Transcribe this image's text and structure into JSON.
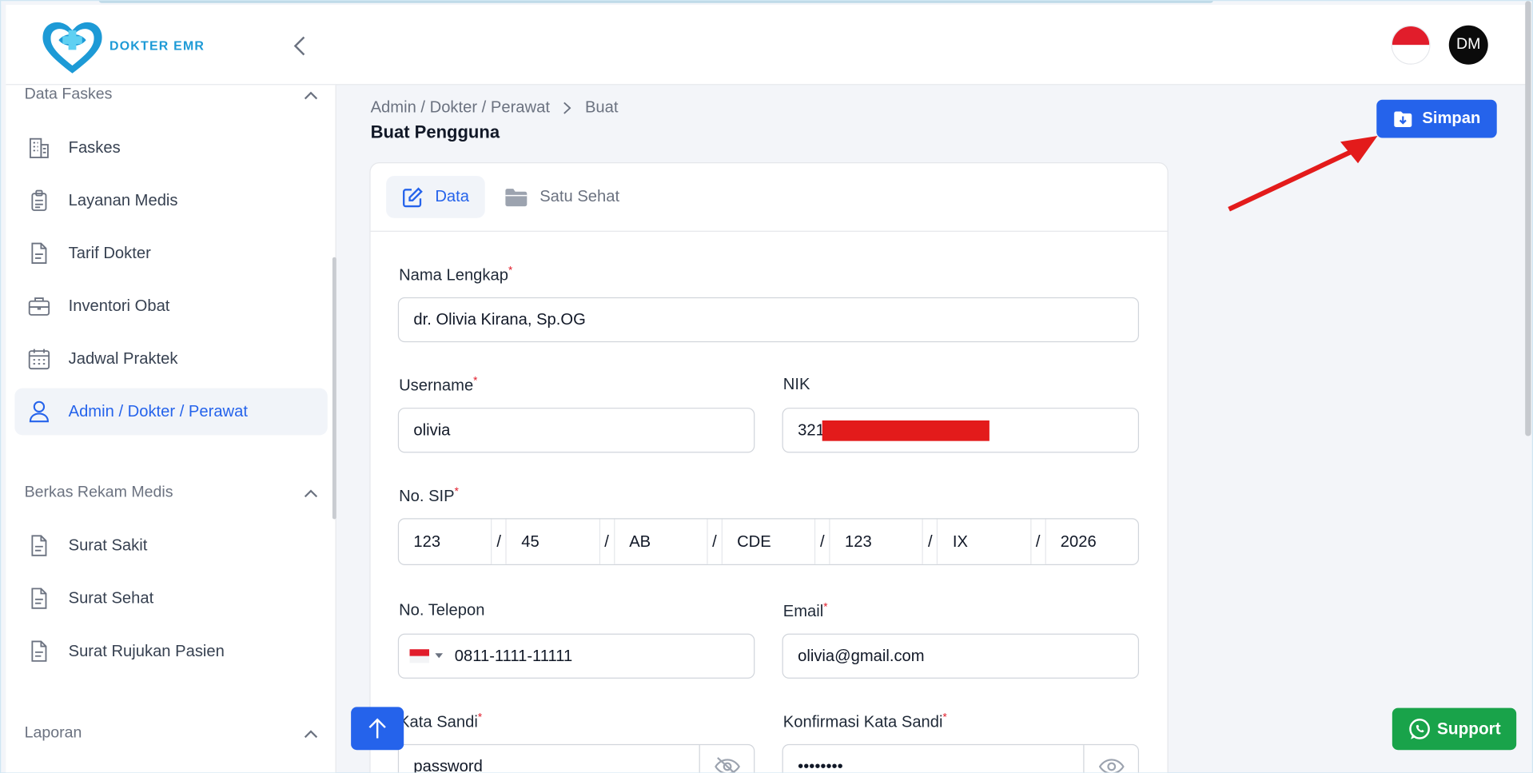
{
  "brand": {
    "name": "DOKTER EMR",
    "accent": "#2563eb",
    "logo_color": "#1d9ad6"
  },
  "header": {
    "avatar_initials": "DM",
    "language_flag": "indonesia-flag-icon"
  },
  "sidebar": {
    "sections": [
      {
        "title": "Data Faskes",
        "items": [
          {
            "label": "Faskes",
            "icon": "building-icon"
          },
          {
            "label": "Layanan Medis",
            "icon": "clipboard-icon"
          },
          {
            "label": "Tarif Dokter",
            "icon": "document-icon"
          },
          {
            "label": "Inventori Obat",
            "icon": "briefcase-icon"
          },
          {
            "label": "Jadwal Praktek",
            "icon": "calendar-icon"
          },
          {
            "label": "Admin / Dokter / Perawat",
            "icon": "user-icon",
            "active": true
          }
        ]
      },
      {
        "title": "Berkas Rekam Medis",
        "items": [
          {
            "label": "Surat Sakit",
            "icon": "document-icon"
          },
          {
            "label": "Surat Sehat",
            "icon": "document-icon"
          },
          {
            "label": "Surat Rujukan Pasien",
            "icon": "document-icon"
          }
        ]
      },
      {
        "title": "Laporan",
        "items": []
      }
    ]
  },
  "breadcrumb": {
    "parent": "Admin / Dokter / Perawat",
    "current": "Buat"
  },
  "page": {
    "title": "Buat Pengguna",
    "save_label": "Simpan"
  },
  "tabs": [
    {
      "label": "Data",
      "icon": "edit-icon",
      "active": true
    },
    {
      "label": "Satu Sehat",
      "icon": "folder-icon",
      "active": false
    }
  ],
  "form": {
    "full_name": {
      "label": "Nama Lengkap",
      "required": "*",
      "value": "dr. Olivia Kirana, Sp.OG"
    },
    "username": {
      "label": "Username",
      "required": "*",
      "value": "olivia"
    },
    "nik": {
      "label": "NIK",
      "value": "321"
    },
    "sip": {
      "label": "No. SIP",
      "required": "*",
      "separator": "/",
      "segments": [
        "123",
        "45",
        "AB",
        "CDE",
        "123",
        "IX",
        "2026"
      ]
    },
    "phone": {
      "label": "No. Telepon",
      "value": "0811-1111-11111"
    },
    "email": {
      "label": "Email",
      "required": "*",
      "value": "olivia@gmail.com"
    },
    "password": {
      "label": "Kata Sandi",
      "required": "*",
      "value": "password"
    },
    "confirm_password": {
      "label": "Konfirmasi Kata Sandi",
      "required": "*",
      "value": "••••••••"
    }
  },
  "support": {
    "label": "Support"
  }
}
